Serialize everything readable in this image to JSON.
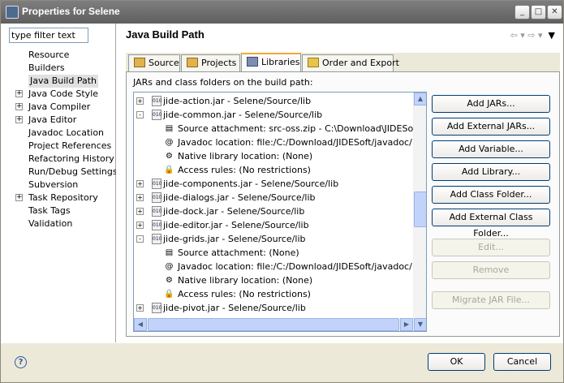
{
  "window": {
    "title": "Properties for Selene"
  },
  "sidebar": {
    "filter_value": "type filter text",
    "items": [
      {
        "label": "Resource",
        "expandable": false
      },
      {
        "label": "Builders",
        "expandable": false
      },
      {
        "label": "Java Build Path",
        "expandable": false,
        "selected": true
      },
      {
        "label": "Java Code Style",
        "expandable": true
      },
      {
        "label": "Java Compiler",
        "expandable": true
      },
      {
        "label": "Java Editor",
        "expandable": true
      },
      {
        "label": "Javadoc Location",
        "expandable": false
      },
      {
        "label": "Project References",
        "expandable": false
      },
      {
        "label": "Refactoring History",
        "expandable": false
      },
      {
        "label": "Run/Debug Settings",
        "expandable": false
      },
      {
        "label": "Subversion",
        "expandable": false
      },
      {
        "label": "Task Repository",
        "expandable": true
      },
      {
        "label": "Task Tags",
        "expandable": false
      },
      {
        "label": "Validation",
        "expandable": false
      }
    ]
  },
  "page": {
    "title": "Java Build Path"
  },
  "tabs": [
    {
      "label": "Source"
    },
    {
      "label": "Projects"
    },
    {
      "label": "Libraries",
      "active": true
    },
    {
      "label": "Order and Export"
    }
  ],
  "libraries": {
    "label": "JARs and class folders on the build path:",
    "rows": [
      {
        "text": "jide-action.jar - Selene/Source/lib",
        "kind": "jar",
        "expander": "+"
      },
      {
        "text": "jide-common.jar - Selene/Source/lib",
        "kind": "jar",
        "expander": "-"
      },
      {
        "text": "Source attachment: src-oss.zip - C:\\Download\\JIDESoft\\src",
        "kind": "attr",
        "icon": "source-attachment-icon"
      },
      {
        "text": "Javadoc location: file:/C:/Download/JIDESoft/javadoc/",
        "kind": "attr",
        "icon": "javadoc-icon"
      },
      {
        "text": "Native library location: (None)",
        "kind": "attr",
        "icon": "native-library-icon"
      },
      {
        "text": "Access rules: (No restrictions)",
        "kind": "attr",
        "icon": "access-rules-icon"
      },
      {
        "text": "jide-components.jar - Selene/Source/lib",
        "kind": "jar",
        "expander": "+"
      },
      {
        "text": "jide-dialogs.jar - Selene/Source/lib",
        "kind": "jar",
        "expander": "+"
      },
      {
        "text": "jide-dock.jar - Selene/Source/lib",
        "kind": "jar",
        "expander": "+"
      },
      {
        "text": "jide-editor.jar - Selene/Source/lib",
        "kind": "jar",
        "expander": "+"
      },
      {
        "text": "jide-grids.jar - Selene/Source/lib",
        "kind": "jar",
        "expander": "-"
      },
      {
        "text": "Source attachment: (None)",
        "kind": "attr",
        "icon": "source-attachment-icon"
      },
      {
        "text": "Javadoc location: file:/C:/Download/JIDESoft/javadoc/",
        "kind": "attr",
        "icon": "javadoc-icon"
      },
      {
        "text": "Native library location: (None)",
        "kind": "attr",
        "icon": "native-library-icon"
      },
      {
        "text": "Access rules: (No restrictions)",
        "kind": "attr",
        "icon": "access-rules-icon"
      },
      {
        "text": "jide-pivot.jar - Selene/Source/lib",
        "kind": "jar",
        "expander": "+"
      }
    ],
    "jar_badge": "010"
  },
  "buttons": {
    "add_jars": "Add JARs...",
    "add_external_jars": "Add External JARs...",
    "add_variable": "Add Variable...",
    "add_library": "Add Library...",
    "add_class_folder": "Add Class Folder...",
    "add_external_class_folder": "Add External Class Folder...",
    "edit": "Edit...",
    "remove": "Remove",
    "migrate_jar": "Migrate JAR File..."
  },
  "dialog": {
    "ok": "OK",
    "cancel": "Cancel",
    "help": "?"
  }
}
